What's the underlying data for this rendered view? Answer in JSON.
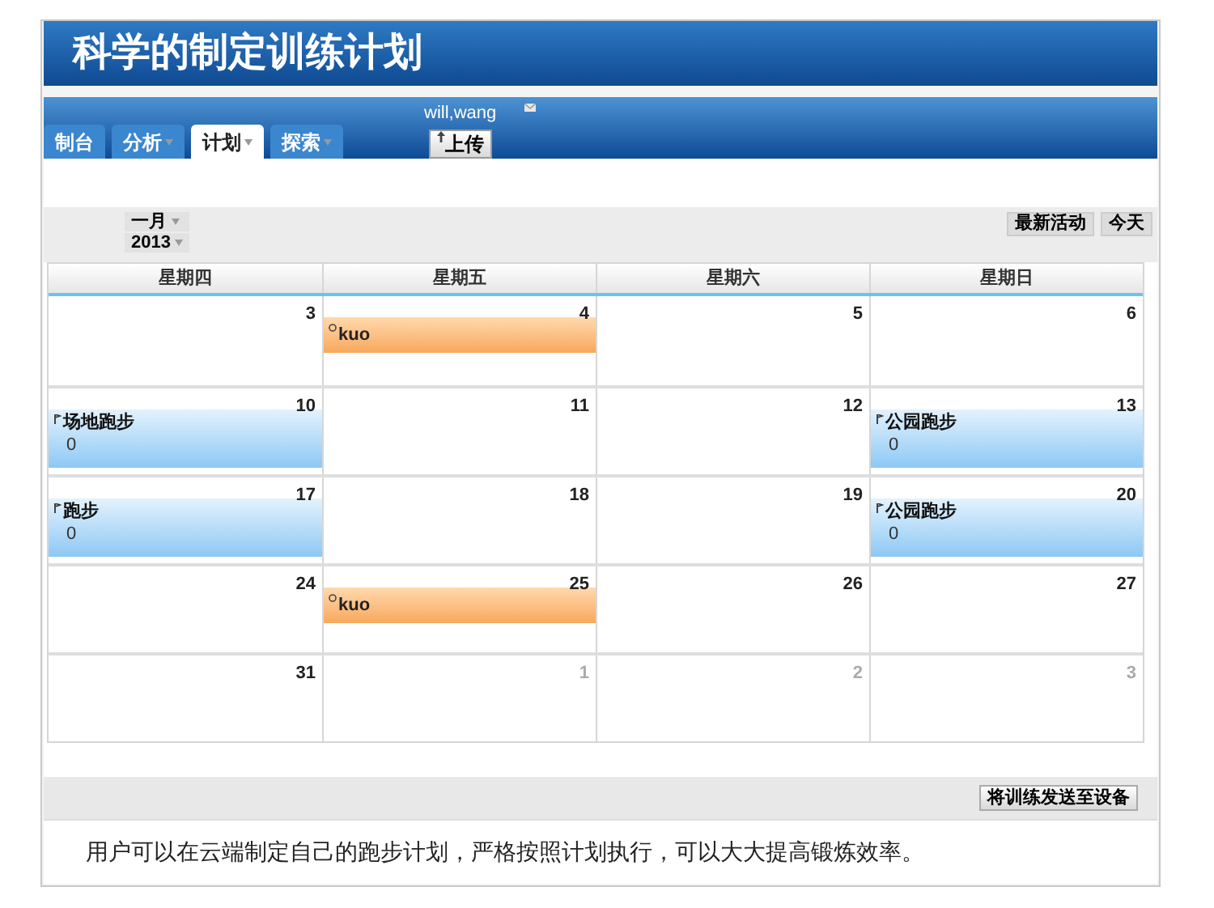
{
  "banner": {
    "title": "科学的制定训练计划"
  },
  "nav": {
    "tabs": [
      {
        "label": "制台",
        "selected": false,
        "dropdown": false
      },
      {
        "label": "分析",
        "selected": false,
        "dropdown": true
      },
      {
        "label": "计划",
        "selected": true,
        "dropdown": true
      },
      {
        "label": "探索",
        "selected": false,
        "dropdown": true
      }
    ],
    "user": "will,wang",
    "upload": "上传"
  },
  "toolbar": {
    "month": "一月",
    "year": "2013",
    "buttons": [
      "最新活动",
      "今天"
    ]
  },
  "calendar": {
    "weekdays": [
      "星期四",
      "星期五",
      "星期六",
      "星期日"
    ],
    "weeks": [
      [
        {
          "day": "3",
          "other_month": false
        },
        {
          "day": "4",
          "other_month": false,
          "events": [
            {
              "kind": "note",
              "title": "kuo"
            }
          ]
        },
        {
          "day": "5",
          "other_month": false
        },
        {
          "day": "6",
          "other_month": false
        }
      ],
      [
        {
          "day": "10",
          "other_month": false,
          "events": [
            {
              "kind": "workout",
              "title": "场地跑步",
              "detail": "0"
            }
          ]
        },
        {
          "day": "11",
          "other_month": false
        },
        {
          "day": "12",
          "other_month": false
        },
        {
          "day": "13",
          "other_month": false,
          "events": [
            {
              "kind": "workout",
              "title": "公园跑步",
              "detail": "0"
            }
          ]
        }
      ],
      [
        {
          "day": "17",
          "other_month": false,
          "events": [
            {
              "kind": "workout",
              "title": "跑步",
              "detail": "0"
            }
          ]
        },
        {
          "day": "18",
          "other_month": false
        },
        {
          "day": "19",
          "other_month": false
        },
        {
          "day": "20",
          "other_month": false,
          "events": [
            {
              "kind": "workout",
              "title": "公园跑步",
              "detail": "0"
            }
          ]
        }
      ],
      [
        {
          "day": "24",
          "other_month": false
        },
        {
          "day": "25",
          "other_month": false,
          "events": [
            {
              "kind": "note",
              "title": "kuo"
            }
          ]
        },
        {
          "day": "26",
          "other_month": false
        },
        {
          "day": "27",
          "other_month": false
        }
      ],
      [
        {
          "day": "31",
          "other_month": false
        },
        {
          "day": "1",
          "other_month": true
        },
        {
          "day": "2",
          "other_month": true
        },
        {
          "day": "3",
          "other_month": true
        }
      ]
    ]
  },
  "send_button": "将训练发送至设备",
  "caption": "用户可以在云端制定自己的跑步计划，严格按照计划执行，可以大大提高锻炼效率。"
}
